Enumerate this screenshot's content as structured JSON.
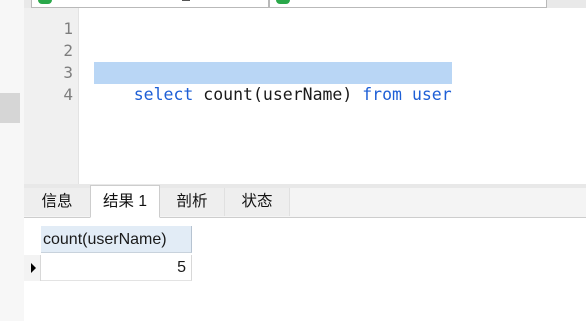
{
  "editor": {
    "line_numbers": [
      "1",
      "2",
      "3",
      "4"
    ],
    "lines": [
      {
        "parts": []
      },
      {
        "parts": [
          {
            "text": "select",
            "kw": true
          },
          {
            "text": " * ",
            "kw": false
          },
          {
            "text": "from",
            "kw": true
          },
          {
            "text": " ",
            "kw": false
          },
          {
            "text": "user",
            "kw": true
          }
        ]
      },
      {
        "parts": [
          {
            "text": "select",
            "kw": true
          },
          {
            "text": " count(userName) ",
            "kw": false
          },
          {
            "text": "from",
            "kw": true
          },
          {
            "text": " ",
            "kw": false
          },
          {
            "text": "user",
            "kw": true
          }
        ]
      },
      {
        "parts": []
      }
    ]
  },
  "result_tabs": [
    "信息",
    "结果 1",
    "剖析",
    "状态"
  ],
  "result_grid": {
    "columns": [
      "count(userName)"
    ],
    "rows": [
      [
        "5"
      ]
    ]
  },
  "colors": {
    "keyword": "#1e5fd6",
    "selection": "#b9d6f5",
    "header": "#e2ecf6"
  }
}
